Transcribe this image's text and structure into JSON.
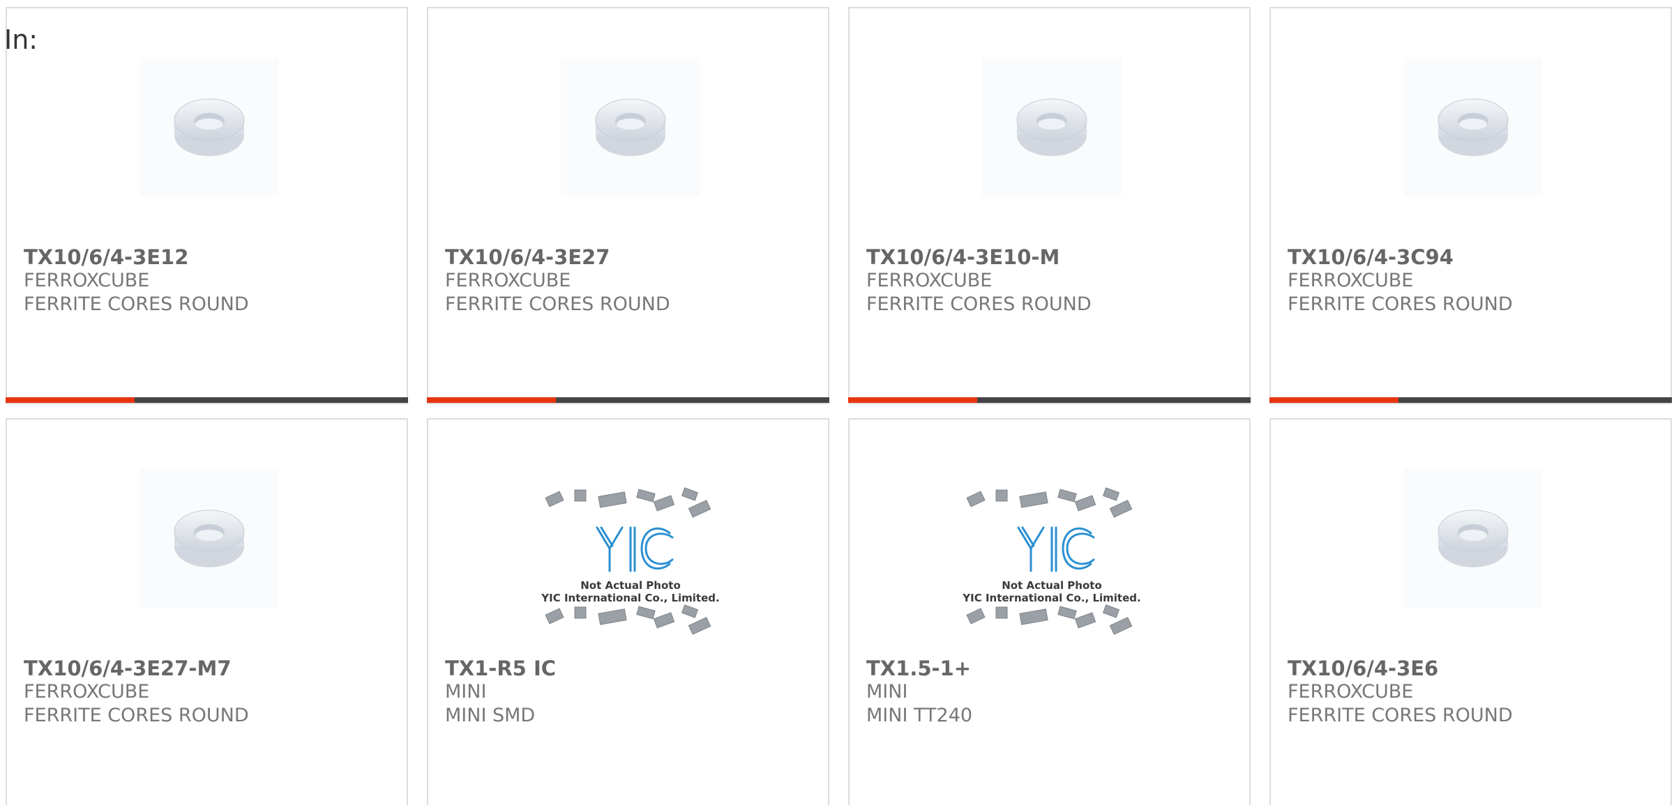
{
  "header": {
    "label": "In:"
  },
  "colors": {
    "accent": "#e8340f",
    "bar": "#444444",
    "text": "#777777"
  },
  "products": [
    {
      "part": "TX10/6/4-3E12",
      "maker": "FERROXCUBE",
      "desc": "FERRITE CORES ROUND",
      "image": "ferrite-ring",
      "bar_progress": 0.32
    },
    {
      "part": "TX10/6/4-3E27",
      "maker": "FERROXCUBE",
      "desc": "FERRITE CORES ROUND",
      "image": "ferrite-ring",
      "bar_progress": 0.32
    },
    {
      "part": "TX10/6/4-3E10-M",
      "maker": "FERROXCUBE",
      "desc": "FERRITE CORES ROUND",
      "image": "ferrite-ring",
      "bar_progress": 0.32
    },
    {
      "part": "TX10/6/4-3C94",
      "maker": "FERROXCUBE",
      "desc": "FERRITE CORES ROUND",
      "image": "ferrite-ring",
      "bar_progress": 0.32
    },
    {
      "part": "TX10/6/4-3E27-M7",
      "maker": "FERROXCUBE",
      "desc": "FERRITE CORES ROUND",
      "image": "ferrite-ring"
    },
    {
      "part": "TX1-R5 IC",
      "maker": "MINI",
      "desc": "MINI SMD",
      "image": "yic-placeholder",
      "placeholder_line1": "Not Actual Photo",
      "placeholder_line2": "YIC International Co., Limited."
    },
    {
      "part": "TX1.5-1+",
      "maker": "MINI",
      "desc": "MINI TT240",
      "image": "yic-placeholder",
      "placeholder_line1": "Not Actual Photo",
      "placeholder_line2": "YIC International Co., Limited."
    },
    {
      "part": "TX10/6/4-3E6",
      "maker": "FERROXCUBE",
      "desc": "FERRITE CORES ROUND",
      "image": "ferrite-ring"
    }
  ]
}
